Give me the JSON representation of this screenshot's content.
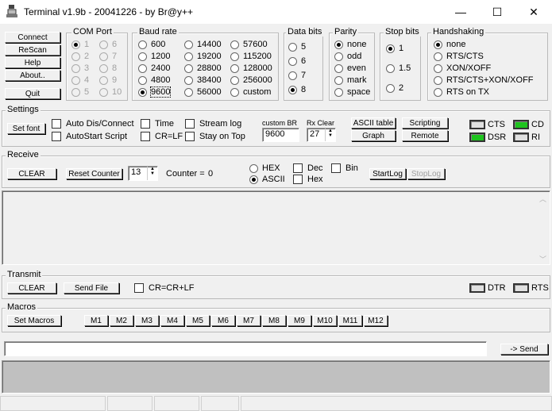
{
  "window": {
    "title": "Terminal v1.9b - 20041226 - by Br@y++",
    "min": "—",
    "max": "☐",
    "close": "✕"
  },
  "left_buttons": [
    "Connect",
    "ReScan",
    "Help",
    "About..",
    "Quit"
  ],
  "com_port": {
    "label": "COM Port",
    "options": [
      "1",
      "2",
      "3",
      "4",
      "5",
      "6",
      "7",
      "8",
      "9",
      "10"
    ],
    "selected": "1"
  },
  "baud_rate": {
    "label": "Baud rate",
    "options": [
      "600",
      "1200",
      "2400",
      "4800",
      "9600",
      "14400",
      "19200",
      "28800",
      "38400",
      "56000",
      "57600",
      "115200",
      "128000",
      "256000",
      "custom"
    ],
    "selected": "9600"
  },
  "data_bits": {
    "label": "Data bits",
    "options": [
      "5",
      "6",
      "7",
      "8"
    ],
    "selected": "8"
  },
  "parity": {
    "label": "Parity",
    "options": [
      "none",
      "odd",
      "even",
      "mark",
      "space"
    ],
    "selected": "none"
  },
  "stop_bits": {
    "label": "Stop bits",
    "options": [
      "1",
      "1.5",
      "2"
    ],
    "selected": "1"
  },
  "handshaking": {
    "label": "Handshaking",
    "options": [
      "none",
      "RTS/CTS",
      "XON/XOFF",
      "RTS/CTS+XON/XOFF",
      "RTS on TX"
    ],
    "selected": "none"
  },
  "settings": {
    "label": "Settings",
    "set_font": "Set font",
    "auto_dis_connect": "Auto Dis/Connect",
    "autostart_script": "AutoStart Script",
    "time": "Time",
    "cr_lf": "CR=LF",
    "stream_log": "Stream log",
    "stay_on_top": "Stay on Top",
    "custom_br_label": "custom BR",
    "custom_br_value": "9600",
    "rx_clear_label": "Rx Clear",
    "rx_clear_value": "27",
    "ascii_table": "ASCII table",
    "graph": "Graph",
    "scripting": "Scripting",
    "remote": "Remote",
    "cts": "CTS",
    "cd": "CD",
    "dsr": "DSR",
    "ri": "RI"
  },
  "receive": {
    "label": "Receive",
    "clear": "CLEAR",
    "reset_counter": "Reset Counter",
    "counter_spin": "13",
    "counter_label": "Counter = ",
    "counter_value": "0",
    "hex": "HEX",
    "ascii": "ASCII",
    "dec": "Dec",
    "hex_chk": "Hex",
    "bin": "Bin",
    "start_log": "StartLog",
    "stop_log": "StopLog"
  },
  "transmit": {
    "label": "Transmit",
    "clear": "CLEAR",
    "send_file": "Send File",
    "cr_crlf": "CR=CR+LF",
    "dtr": "DTR",
    "rts": "RTS"
  },
  "macros": {
    "label": "Macros",
    "set_macros": "Set Macros",
    "items": [
      "M1",
      "M2",
      "M3",
      "M4",
      "M5",
      "M6",
      "M7",
      "M8",
      "M9",
      "M10",
      "M11",
      "M12"
    ]
  },
  "send": {
    "input_value": "",
    "button": "-> Send"
  },
  "icons": {
    "app": "terminal-app-icon",
    "scroll_up": "chevron-up-icon",
    "scroll_down": "chevron-down-icon"
  }
}
